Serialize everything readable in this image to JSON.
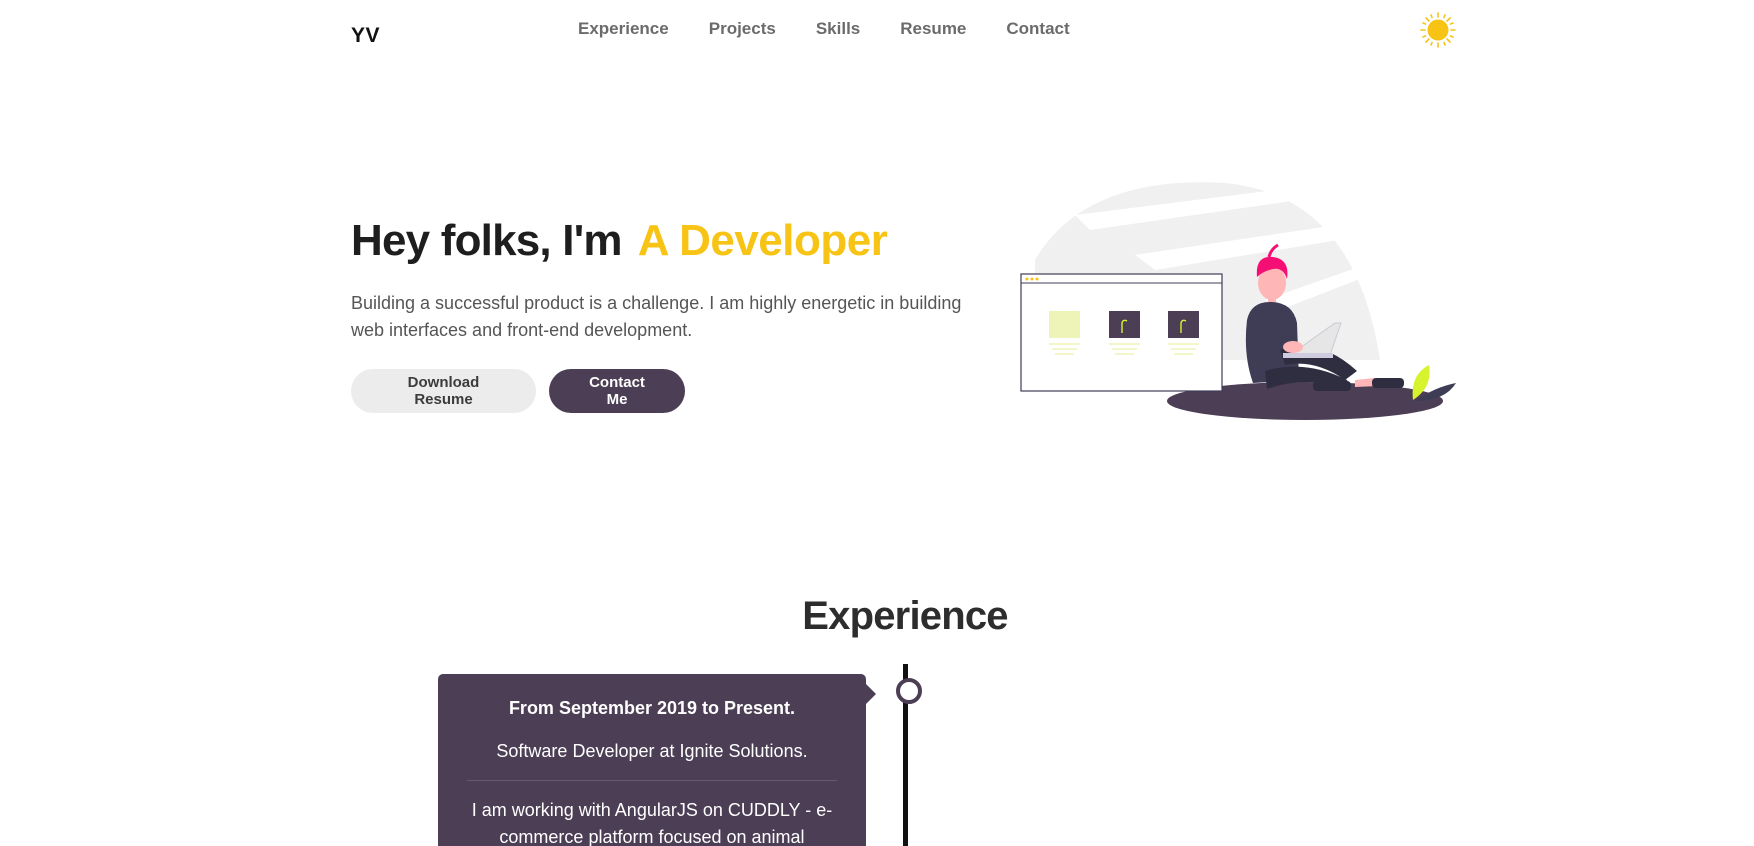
{
  "nav": {
    "logo": "YV",
    "links": [
      "Experience",
      "Projects",
      "Skills",
      "Resume",
      "Contact"
    ],
    "theme_icon": "sun-icon"
  },
  "hero": {
    "greeting": "Hey folks, I'm",
    "role": "A Developer",
    "description": "Building a successful product is a challenge. I am highly energetic in building web interfaces and front-end development.",
    "download_label": "Download Resume",
    "contact_label": "Contact Me",
    "illustration_icon": "developer-with-laptop-illustration"
  },
  "experience": {
    "title": "Experience",
    "items": [
      {
        "period": "From September 2019 to Present.",
        "role": "Software Developer at Ignite Solutions.",
        "description": "I am working with AngularJS on CUDDLY - e-commerce platform focused on animal"
      }
    ]
  },
  "colors": {
    "accent": "#f7c315",
    "primary": "#4b3e55",
    "button_light": "#ececec",
    "pink": "#f50f74",
    "lime": "#d7f32e"
  }
}
